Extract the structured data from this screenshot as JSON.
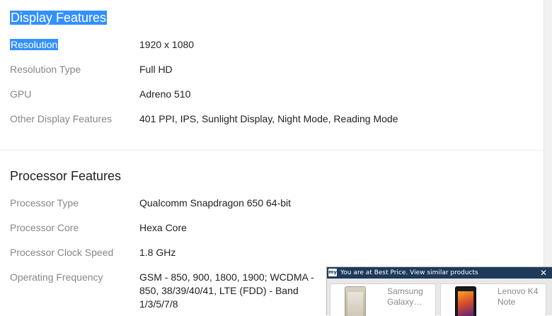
{
  "display": {
    "title": "Display Features",
    "rows": [
      {
        "label": "Resolution",
        "value": "1920 x 1080"
      },
      {
        "label": "Resolution Type",
        "value": "Full HD"
      },
      {
        "label": "GPU",
        "value": "Adreno 510"
      },
      {
        "label": "Other Display Features",
        "value": "401 PPI, IPS, Sunlight Display, Night Mode, Reading Mode"
      }
    ]
  },
  "processor": {
    "title": "Processor Features",
    "rows": [
      {
        "label": "Processor Type",
        "value": "Qualcomm Snapdragon 650 64-bit"
      },
      {
        "label": "Processor Core",
        "value": "Hexa Core"
      },
      {
        "label": "Processor Clock Speed",
        "value": "1.8 GHz"
      },
      {
        "label": "Operating Frequency",
        "value": "GSM - 850, 900, 1800, 1900; WCDMA - 850, 38/39/40/41, LTE (FDD) - Band 1/3/5/7/8"
      }
    ]
  },
  "popup": {
    "logo": "my",
    "message": "You are at Best Price. View similar products",
    "close": "✕",
    "products": [
      {
        "name": "Samsung Galaxy…",
        "icon": "phone-thumbnail"
      },
      {
        "name": "Lenovo K4 Note",
        "icon": "phone-thumbnail"
      }
    ]
  },
  "colors": {
    "selection": "#3390ff",
    "label_gray": "#878787",
    "popup_bar": "#1d3a5b"
  }
}
